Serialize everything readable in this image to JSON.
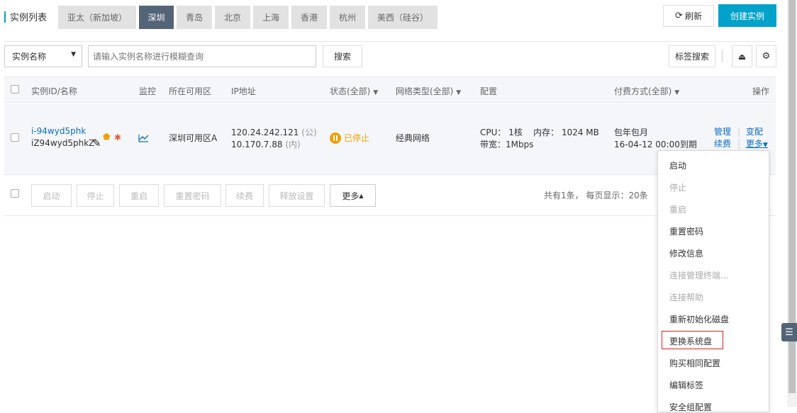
{
  "header": {
    "title": "实例列表",
    "regions": [
      "亚太（新加坡）",
      "深圳",
      "青岛",
      "北京",
      "上海",
      "香港",
      "杭州",
      "美西（硅谷）"
    ],
    "active_region": "深圳",
    "refresh_label": "刷新",
    "create_label": "创建实例"
  },
  "search": {
    "field_select": "实例名称",
    "placeholder": "请输入实例名称进行模糊查询",
    "search_button": "搜索",
    "tag_search_button": "标签搜索"
  },
  "table": {
    "columns": {
      "id": "实例ID/名称",
      "monitor": "监控",
      "zone": "所在可用区",
      "ip": "IP地址",
      "status": "状态(全部)",
      "network": "网络类型(全部)",
      "config": "配置",
      "billing": "付费方式(全部)",
      "actions": "操作"
    },
    "row": {
      "instance_id": "i-94wyd5phk",
      "instance_name": "iZ94wyd5phkZ",
      "zone": "深圳可用区A",
      "public_ip": "120.24.242.121",
      "public_tag": "(公)",
      "private_ip": "10.170.7.88",
      "private_tag": "(内)",
      "status": "已停止",
      "network": "经典网络",
      "config_cpu": "CPU： 1核",
      "config_mem": "内存： 1024 MB",
      "config_bw": "带宽：1Mbps",
      "billing_type": "包年包月",
      "expire": "16-04-12 00:00到期",
      "action_manage": "管理",
      "action_change": "变配",
      "action_renew": "续费",
      "action_more": "更多"
    }
  },
  "batch": {
    "start": "启动",
    "stop": "停止",
    "restart": "重启",
    "reset_password": "重置密码",
    "renew": "续费",
    "release": "释放设置",
    "more": "更多",
    "pagination_text": "共有1条， 每页显示：20条"
  },
  "dropdown": {
    "items": [
      {
        "label": "启动",
        "disabled": false
      },
      {
        "label": "停止",
        "disabled": true
      },
      {
        "label": "重启",
        "disabled": true
      },
      {
        "label": "重置密码",
        "disabled": false
      },
      {
        "label": "修改信息",
        "disabled": false
      },
      {
        "label": "连接管理终端...",
        "disabled": true
      },
      {
        "label": "连接帮助",
        "disabled": true
      },
      {
        "label": "重新初始化磁盘",
        "disabled": false
      },
      {
        "label": "更换系统盘",
        "disabled": false,
        "highlighted": true
      },
      {
        "label": "购买相同配置",
        "disabled": false
      },
      {
        "label": "编辑标签",
        "disabled": false
      },
      {
        "label": "安全组配置",
        "disabled": false
      }
    ]
  },
  "colors": {
    "accent": "#00a2ca",
    "active_tab": "#546477",
    "link": "#0a6fc2",
    "status_stopped": "#f0a000",
    "highlight_border": "#e02020"
  }
}
